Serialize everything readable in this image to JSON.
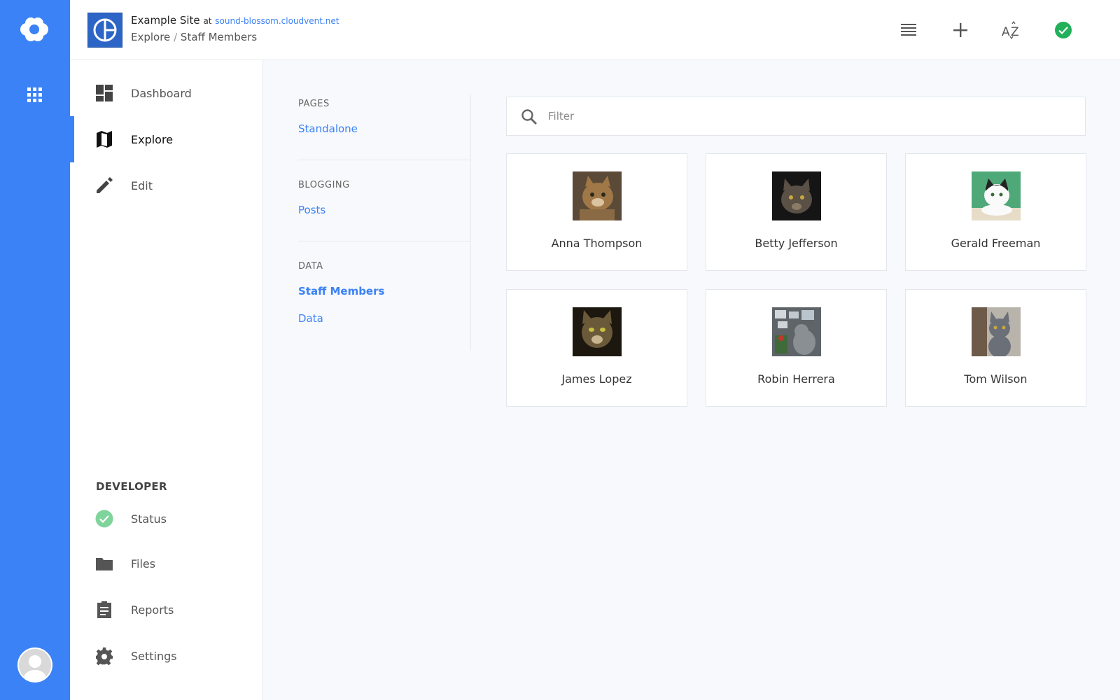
{
  "header": {
    "site_name": "Example Site",
    "at_label": "at",
    "site_url": "sound-blossom.cloudvent.net",
    "breadcrumb": [
      "Explore",
      "Staff Members"
    ],
    "breadcrumb_sep": "/",
    "buttons": [
      {
        "name": "list-view-icon"
      },
      {
        "name": "plus-icon"
      },
      {
        "name": "sort-az-icon"
      },
      {
        "name": "status-check-icon"
      }
    ]
  },
  "rail": {
    "logo_icon": "cloud-logo-icon",
    "apps_icon": "apps-grid-icon",
    "avatar_icon": "user-avatar-icon",
    "color": "#3b82f6"
  },
  "sidebar": {
    "items": [
      {
        "label": "Dashboard",
        "icon": "dashboard-icon"
      },
      {
        "label": "Explore",
        "icon": "map-icon",
        "active": true
      },
      {
        "label": "Edit",
        "icon": "pencil-icon"
      }
    ],
    "developer_heading": "DEVELOPER",
    "developer_items": [
      {
        "label": "Status",
        "icon": "status-check-icon"
      },
      {
        "label": "Files",
        "icon": "folder-icon"
      },
      {
        "label": "Reports",
        "icon": "clipboard-icon"
      },
      {
        "label": "Settings",
        "icon": "gear-icon"
      }
    ]
  },
  "sections": [
    {
      "heading": "PAGES",
      "links": [
        "Standalone"
      ]
    },
    {
      "heading": "BLOGGING",
      "links": [
        "Posts"
      ]
    },
    {
      "heading": "DATA",
      "links": [
        "Staff Members",
        "Data"
      ],
      "current": "Staff Members"
    }
  ],
  "filter": {
    "placeholder": "Filter",
    "value": ""
  },
  "staff": [
    {
      "name": "Anna Thompson",
      "photo": "cat-photo"
    },
    {
      "name": "Betty Jefferson",
      "photo": "cat-photo"
    },
    {
      "name": "Gerald Freeman",
      "photo": "cat-photo"
    },
    {
      "name": "James Lopez",
      "photo": "cat-photo"
    },
    {
      "name": "Robin Herrera",
      "photo": "cat-photo"
    },
    {
      "name": "Tom Wilson",
      "photo": "cat-photo"
    }
  ],
  "colors": {
    "accent": "#3b82f6",
    "success": "#22b05a",
    "success_light": "#7fd49b"
  }
}
